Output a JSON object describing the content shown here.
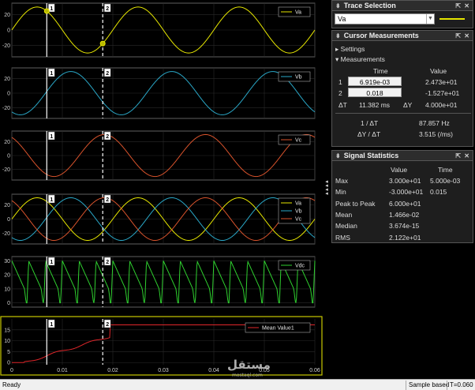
{
  "scope": {
    "plots": [
      {
        "legend": [
          "Va"
        ],
        "colors": [
          "#e6e600"
        ],
        "yticks": [
          "20",
          "0",
          "-20"
        ]
      },
      {
        "legend": [
          "Vb"
        ],
        "colors": [
          "#2aa8c8"
        ],
        "yticks": [
          "20",
          "0",
          "-20"
        ]
      },
      {
        "legend": [
          "Vc"
        ],
        "colors": [
          "#d9532c"
        ],
        "yticks": [
          "20",
          "0",
          "-20"
        ]
      },
      {
        "legend": [
          "Va",
          "Vb",
          "Vc"
        ],
        "colors": [
          "#e6e600",
          "#2aa8c8",
          "#d9532c"
        ],
        "yticks": [
          "20",
          "0",
          "-20"
        ]
      },
      {
        "legend": [
          "Vdc"
        ],
        "colors": [
          "#2fd02f"
        ],
        "yticks": [
          "30",
          "20",
          "10",
          "0"
        ]
      },
      {
        "legend": [
          "Mean Value1"
        ],
        "colors": [
          "#e0262a"
        ],
        "yticks": [
          "15",
          "10",
          "5",
          "0"
        ]
      }
    ],
    "xticks": [
      "0",
      "0.01",
      "0.02",
      "0.03",
      "0.04",
      "0.05",
      "0.06"
    ],
    "cursor_labels": [
      "1",
      "2"
    ],
    "watermark": "مستقل",
    "watermark_sub": "mostaql.com"
  },
  "chart_data": {
    "type": "line",
    "x_range": [
      0,
      0.06
    ],
    "amplitude": 30,
    "frequency_hz": 50,
    "cursors": {
      "t1": 0.006919,
      "t2": 0.018
    },
    "series": [
      {
        "name": "Va",
        "phase_deg": 0,
        "ylim": [
          -35,
          35
        ]
      },
      {
        "name": "Vb",
        "phase_deg": -120,
        "ylim": [
          -35,
          35
        ]
      },
      {
        "name": "Vc",
        "phase_deg": 120,
        "ylim": [
          -35,
          35
        ]
      },
      {
        "name": "Vdc",
        "description": "rectified ripple",
        "ylim": [
          -3,
          33
        ]
      },
      {
        "name": "Mean Value1",
        "final_value": 17.3,
        "ylim": [
          -1,
          20
        ]
      }
    ]
  },
  "trace_selection": {
    "title": "Trace Selection",
    "selected": "Va",
    "swatch_color": "#e6e600"
  },
  "cursor_measurements": {
    "title": "Cursor Measurements",
    "settings_label": "Settings",
    "measurements_label": "Measurements",
    "col_time": "Time",
    "col_value": "Value",
    "row1_label": "1",
    "row1_time": "6.919e-03",
    "row1_value": "2.473e+01",
    "row2_label": "2",
    "row2_time": "0.018",
    "row2_value": "-1.527e+01",
    "dt_label": "ΔT",
    "dt_value": "11.382 ms",
    "dy_label": "ΔY",
    "dy_value": "4.000e+01",
    "inv_dt_label": "1 / ΔT",
    "inv_dt_value": "87.857 Hz",
    "dydt_label": "ΔY / ΔT",
    "dydt_value": "3.515 (/ms)"
  },
  "signal_statistics": {
    "title": "Signal Statistics",
    "col_value": "Value",
    "col_time": "Time",
    "rows": [
      {
        "label": "Max",
        "value": "3.000e+01",
        "time": "5.000e-03"
      },
      {
        "label": "Min",
        "value": "-3.000e+01",
        "time": "0.015"
      },
      {
        "label": "Peak to Peak",
        "value": "6.000e+01",
        "time": ""
      },
      {
        "label": "Mean",
        "value": "1.466e-02",
        "time": ""
      },
      {
        "label": "Median",
        "value": "3.674e-15",
        "time": ""
      },
      {
        "label": "RMS",
        "value": "2.122e+01",
        "time": ""
      }
    ]
  },
  "status": {
    "ready": "Ready",
    "mode": "Sample based",
    "time": "T=0.060"
  }
}
